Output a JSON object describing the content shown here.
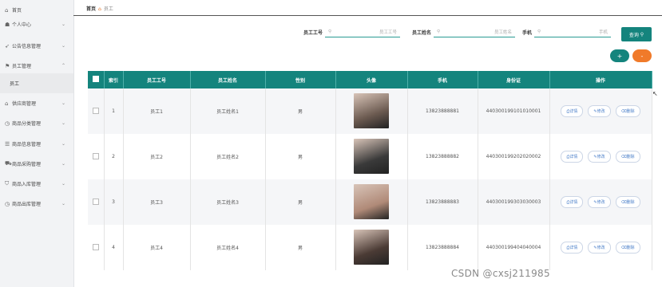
{
  "sidebar": {
    "items": [
      {
        "icon": "home-icon",
        "glyph": "⌂",
        "label": "首页",
        "chev": ""
      },
      {
        "icon": "user-icon",
        "glyph": "☗",
        "label": "个人中心",
        "chev": "⌄"
      },
      {
        "icon": "send-icon",
        "glyph": "➶",
        "label": "公告信息管理",
        "chev": "⌄"
      },
      {
        "icon": "flag-icon",
        "glyph": "⚑",
        "label": "员工管理",
        "chev": "⌃"
      },
      {
        "icon": "",
        "glyph": "",
        "label": "员工",
        "chev": ""
      },
      {
        "icon": "bank-icon",
        "glyph": "⌂",
        "label": "供应商管理",
        "chev": "⌄"
      },
      {
        "icon": "clock-icon",
        "glyph": "◷",
        "label": "商品分类管理",
        "chev": "⌄"
      },
      {
        "icon": "list-icon",
        "glyph": "☰",
        "label": "商品信息管理",
        "chev": "⌄"
      },
      {
        "icon": "cart-icon",
        "glyph": "⛟",
        "label": "商品采购管理",
        "chev": "⌄"
      },
      {
        "icon": "inbox-icon",
        "glyph": "⛉",
        "label": "商品入库管理",
        "chev": "⌄"
      },
      {
        "icon": "clock-icon",
        "glyph": "◷",
        "label": "商品出库管理",
        "chev": "⌄"
      }
    ]
  },
  "breadcrumb": {
    "home": "首页",
    "current": "员工"
  },
  "search": {
    "emp_no_label": "员工工号",
    "emp_no_placeholder": "员工工号",
    "emp_name_label": "员工姓名",
    "emp_name_placeholder": "员工姓名",
    "phone_label": "手机",
    "phone_placeholder": "手机",
    "query_label": "查询"
  },
  "actions": {
    "add": "+",
    "delete": "-"
  },
  "table": {
    "headers": [
      "索引",
      "员工工号",
      "员工姓名",
      "性别",
      "头像",
      "手机",
      "身份证",
      "操作"
    ],
    "rows": [
      {
        "index": "1",
        "no": "员工1",
        "name": "员工姓名1",
        "sex": "男",
        "phone": "13823888881",
        "idcard": "440300199101010001",
        "avatar": "#6b5a50"
      },
      {
        "index": "2",
        "no": "员工2",
        "name": "员工姓名2",
        "sex": "男",
        "phone": "13823888882",
        "idcard": "440300199202020002",
        "avatar": "#3a3a3a"
      },
      {
        "index": "3",
        "no": "员工3",
        "name": "员工姓名3",
        "sex": "男",
        "phone": "13823888883",
        "idcard": "440300199303030003",
        "avatar": "#b08a78"
      },
      {
        "index": "4",
        "no": "员工4",
        "name": "员工姓名4",
        "sex": "男",
        "phone": "13823888884",
        "idcard": "440300199404040004",
        "avatar": "#4b3b35"
      }
    ],
    "ops": {
      "detail": "详情",
      "edit": "修改",
      "remove": "删除"
    }
  },
  "watermark": "CSDN @cxsj211985"
}
